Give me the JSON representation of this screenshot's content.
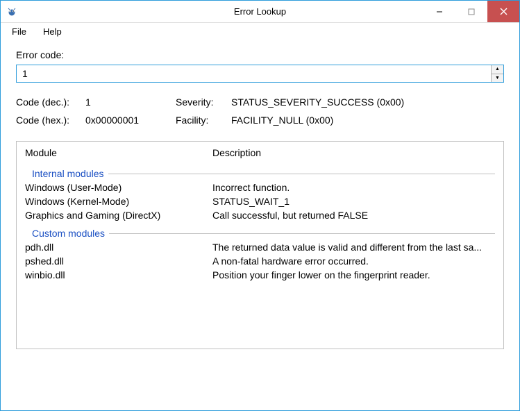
{
  "window": {
    "title": "Error Lookup"
  },
  "menu": {
    "file": "File",
    "help": "Help"
  },
  "form": {
    "label": "Error code:",
    "value": "1"
  },
  "meta": {
    "code_dec_label": "Code (dec.):",
    "code_dec_value": "1",
    "code_hex_label": "Code (hex.):",
    "code_hex_value": "0x00000001",
    "severity_label": "Severity:",
    "severity_value": "STATUS_SEVERITY_SUCCESS (0x00)",
    "facility_label": "Facility:",
    "facility_value": "FACILITY_NULL (0x00)"
  },
  "results": {
    "col_module": "Module",
    "col_desc": "Description",
    "group_internal": "Internal modules",
    "group_custom": "Custom modules",
    "internal": [
      {
        "module": "Windows (User-Mode)",
        "desc": "Incorrect function."
      },
      {
        "module": "Windows (Kernel-Mode)",
        "desc": "STATUS_WAIT_1"
      },
      {
        "module": "Graphics and Gaming (DirectX)",
        "desc": "Call successful, but returned FALSE"
      }
    ],
    "custom": [
      {
        "module": "pdh.dll",
        "desc": "The returned data value is valid and different from the last sa..."
      },
      {
        "module": "pshed.dll",
        "desc": "A non-fatal hardware error occurred."
      },
      {
        "module": "winbio.dll",
        "desc": "Position your finger lower on the fingerprint reader."
      }
    ]
  }
}
